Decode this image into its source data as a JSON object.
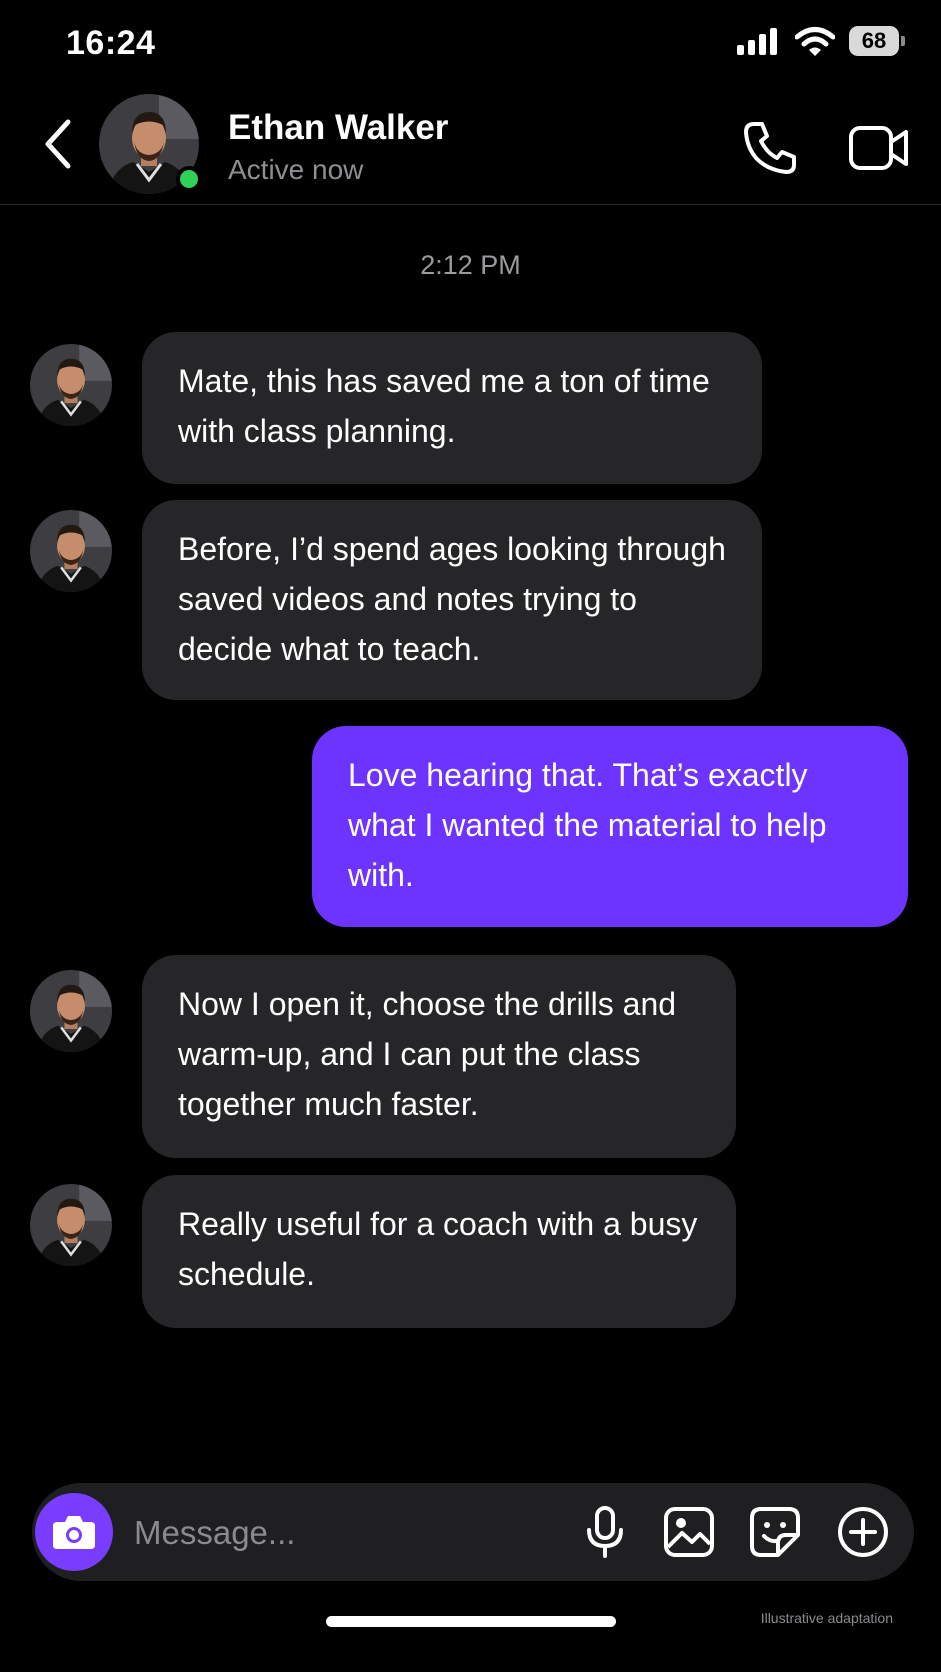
{
  "status_bar": {
    "time": "16:24",
    "battery": "68"
  },
  "header": {
    "name": "Ethan Walker",
    "status": "Active now",
    "icons": [
      "back-chevron-icon",
      "phone-icon",
      "video-camera-icon"
    ]
  },
  "chat": {
    "timestamp": "2:12 PM",
    "messages": [
      {
        "from": "contact",
        "text": "Mate, this has saved me a ton of time with class planning."
      },
      {
        "from": "contact",
        "text": "Before, I’d spend ages looking through saved videos and notes trying to decide what to teach."
      },
      {
        "from": "me",
        "text": "Love hearing that. That’s exactly what I wanted the material to help with."
      },
      {
        "from": "contact",
        "text": "Now I open it, choose the drills and warm-up, and I can put the class together much faster."
      },
      {
        "from": "contact",
        "text": "Really useful for a coach with a busy schedule."
      }
    ]
  },
  "input": {
    "placeholder": "Message...",
    "icons": [
      "camera-icon",
      "microphone-icon",
      "gallery-icon",
      "sticker-icon",
      "plus-icon"
    ]
  },
  "colors": {
    "outgoing_bubble": "#6e34ff",
    "incoming_bubble": "#262628",
    "online": "#31d158"
  },
  "watermark": "Illustrative adaptation"
}
